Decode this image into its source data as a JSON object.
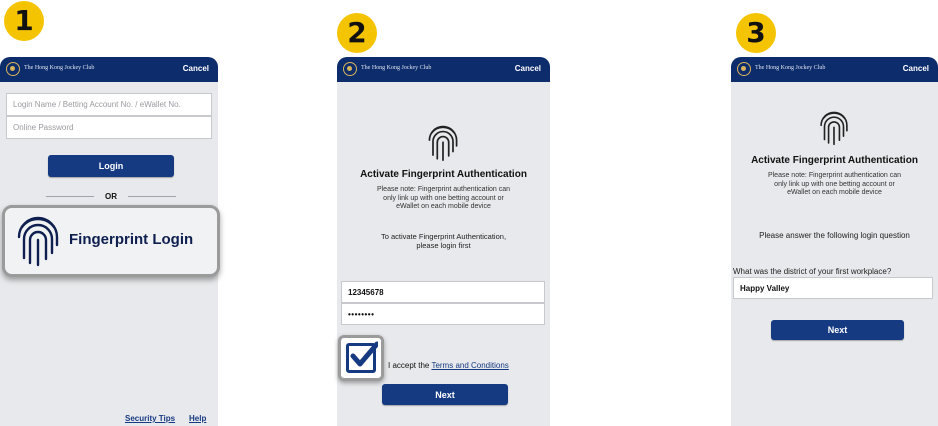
{
  "steps": [
    "1",
    "2",
    "3"
  ],
  "header": {
    "club_name": "The Hong Kong Jockey Club",
    "cancel_label": "Cancel"
  },
  "screen1": {
    "login_placeholder": "Login Name / Betting Account No. / eWallet No.",
    "password_placeholder": "Online Password",
    "login_label": "Login",
    "or_label": "OR",
    "fingerprint_label": "Fingerprint Login",
    "security_tips_label": "Security Tips",
    "help_label": "Help"
  },
  "screen2": {
    "title": "Activate Fingerprint Authentication",
    "note_lines": [
      "Please note: Fingerprint authentication can",
      "only link up with one betting account or",
      "eWallet on each mobile device"
    ],
    "activate_lines": [
      "To activate Fingerprint Authentication,",
      "please login first"
    ],
    "account_value": "12345678",
    "password_value": "••••••••",
    "accept_prefix": "I accept the ",
    "terms_label": "Terms and Conditions",
    "next_label": "Next"
  },
  "screen3": {
    "title": "Activate Fingerprint Authentication",
    "note_lines": [
      "Please note: Fingerprint authentication can",
      "only link up with one betting account or",
      "eWallet on each mobile device"
    ],
    "instruction": "Please answer the following login question",
    "question": "What was the district of your first workplace?",
    "answer_value": "Happy Valley",
    "next_label": "Next"
  },
  "colors": {
    "badge": "#f5c400",
    "header": "#0d2c6c",
    "button": "#163a82",
    "screen_bg": "#e8e9ec"
  }
}
